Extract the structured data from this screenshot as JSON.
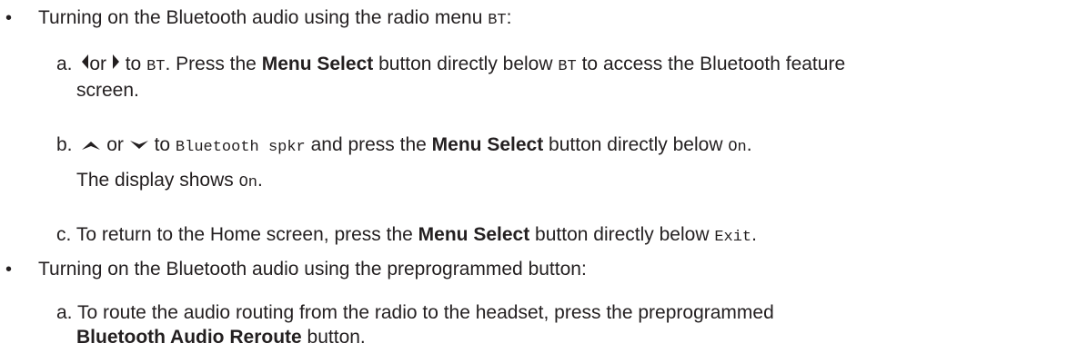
{
  "bullets": [
    {
      "marker": "•",
      "text": "Turning on the Bluetooth audio using the radio menu ",
      "code": "BT",
      "suffix": ":",
      "steps": [
        {
          "letter": "a.",
          "or": "or",
          "to": " to ",
          "code1": "BT",
          "t1": ". Press the ",
          "bold": "Menu Select",
          "t2": " button directly below ",
          "code2": "BT",
          "t3": " to access the Bluetooth feature",
          "cont": "screen."
        },
        {
          "letter": "b.",
          "or": "or",
          "to": " to ",
          "code1": "Bluetooth spkr",
          "t1": " and press the ",
          "bold": "Menu Select",
          "t2": " button directly below ",
          "code2": "On",
          "t3": ".",
          "note_text": "The display shows ",
          "note_code": "On",
          "note_end": "."
        },
        {
          "letter": "c.",
          "t1": "To return to the Home screen, press the ",
          "bold": "Menu Select",
          "t2": " button directly below ",
          "code": "Exit",
          "t3": "."
        }
      ]
    },
    {
      "marker": "•",
      "text": "Turning on the Bluetooth audio using the preprogrammed button:",
      "steps": [
        {
          "letter": "a.",
          "t1": "To route the audio routing from the radio to the headset, press the preprogrammed",
          "bold": "Bluetooth Audio Reroute",
          "t2": " button."
        }
      ]
    }
  ],
  "icons": {
    "left": "left-arrow-icon",
    "right": "right-arrow-icon",
    "up": "up-arrow-icon",
    "down": "down-arrow-icon"
  },
  "colors": {
    "text": "#231f20"
  }
}
